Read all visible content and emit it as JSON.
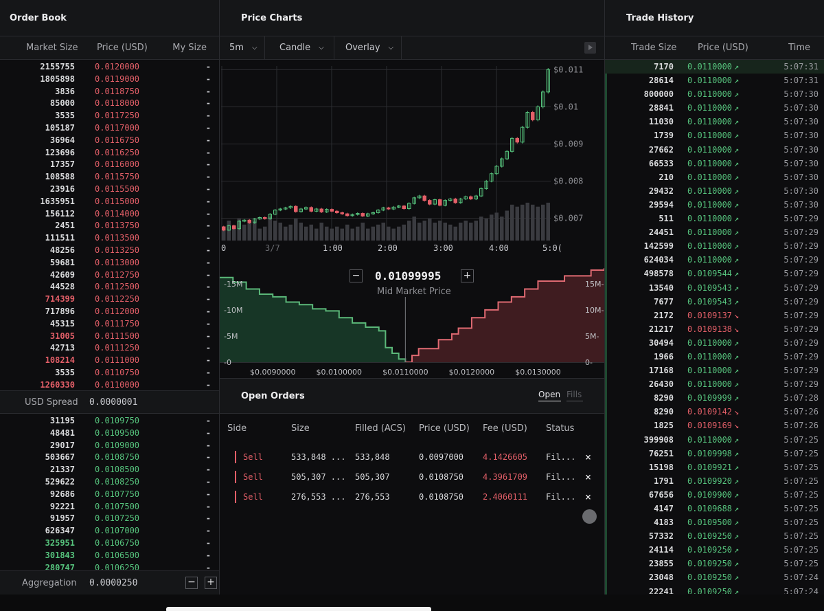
{
  "order_book": {
    "title": "Order Book",
    "col_market_size": "Market Size",
    "col_price": "Price (USD)",
    "col_my_size": "My Size",
    "asks": [
      {
        "size": "2155755",
        "price": "0.0120000",
        "my": "-"
      },
      {
        "size": "1805898",
        "price": "0.0119000",
        "my": "-"
      },
      {
        "size": "3836",
        "price": "0.0118750",
        "my": "-"
      },
      {
        "size": "85000",
        "price": "0.0118000",
        "my": "-"
      },
      {
        "size": "3535",
        "price": "0.0117250",
        "my": "-"
      },
      {
        "size": "105187",
        "price": "0.0117000",
        "my": "-"
      },
      {
        "size": "36964",
        "price": "0.0116750",
        "my": "-"
      },
      {
        "size": "123696",
        "price": "0.0116250",
        "my": "-"
      },
      {
        "size": "17357",
        "price": "0.0116000",
        "my": "-"
      },
      {
        "size": "108588",
        "price": "0.0115750",
        "my": "-"
      },
      {
        "size": "23916",
        "price": "0.0115500",
        "my": "-"
      },
      {
        "size": "1635951",
        "price": "0.0115000",
        "my": "-"
      },
      {
        "size": "156112",
        "price": "0.0114000",
        "my": "-"
      },
      {
        "size": "2451",
        "price": "0.0113750",
        "my": "-"
      },
      {
        "size": "111511",
        "price": "0.0113500",
        "my": "-"
      },
      {
        "size": "48256",
        "price": "0.0113250",
        "my": "-"
      },
      {
        "size": "59681",
        "price": "0.0113000",
        "my": "-"
      },
      {
        "size": "42609",
        "price": "0.0112750",
        "my": "-"
      },
      {
        "size": "44528",
        "price": "0.0112500",
        "my": "-"
      },
      {
        "size": "714399",
        "price": "0.0112250",
        "my": "-",
        "hl": true
      },
      {
        "size": "717896",
        "price": "0.0112000",
        "my": "-"
      },
      {
        "size": "45315",
        "price": "0.0111750",
        "my": "-"
      },
      {
        "size": "31005",
        "price": "0.0111500",
        "my": "-",
        "hl": true
      },
      {
        "size": "42713",
        "price": "0.0111250",
        "my": "-"
      },
      {
        "size": "108214",
        "price": "0.0111000",
        "my": "-",
        "hl": true
      },
      {
        "size": "3535",
        "price": "0.0110750",
        "my": "-"
      },
      {
        "size": "1260330",
        "price": "0.0110000",
        "my": "-",
        "hl": true
      }
    ],
    "spread_label": "USD Spread",
    "spread_value": "0.0000001",
    "bids": [
      {
        "size": "31195",
        "price": "0.0109750",
        "my": "-"
      },
      {
        "size": "48481",
        "price": "0.0109500",
        "my": "-"
      },
      {
        "size": "29017",
        "price": "0.0109000",
        "my": "-"
      },
      {
        "size": "503667",
        "price": "0.0108750",
        "my": "-"
      },
      {
        "size": "21337",
        "price": "0.0108500",
        "my": "-"
      },
      {
        "size": "529622",
        "price": "0.0108250",
        "my": "-"
      },
      {
        "size": "92686",
        "price": "0.0107750",
        "my": "-"
      },
      {
        "size": "92221",
        "price": "0.0107500",
        "my": "-"
      },
      {
        "size": "91957",
        "price": "0.0107250",
        "my": "-"
      },
      {
        "size": "626347",
        "price": "0.0107000",
        "my": "-"
      },
      {
        "size": "325951",
        "price": "0.0106750",
        "my": "-",
        "hl": true
      },
      {
        "size": "301843",
        "price": "0.0106500",
        "my": "-",
        "hl": true
      },
      {
        "size": "280747",
        "price": "0.0106250",
        "my": "-",
        "hl": true
      }
    ],
    "aggregation_label": "Aggregation",
    "aggregation_value": "0.0000250",
    "minus": "−",
    "plus": "+"
  },
  "price_charts": {
    "title": "Price Charts",
    "interval": "5m",
    "chart_type": "Candle",
    "overlay": "Overlay",
    "mid_market_price": "0.01099995",
    "mid_market_label": "Mid Market Price",
    "minus": "−",
    "plus": "+"
  },
  "chart_data": [
    {
      "type": "candlestick",
      "y_ticks": [
        "$0.011",
        "$0.01",
        "$0.009",
        "$0.008",
        "$0.007"
      ],
      "y_tick_values": [
        0.011,
        0.01,
        0.009,
        0.008,
        0.007
      ],
      "x_ticks": [
        "0",
        "3/7",
        "1:00",
        "2:00",
        "3:00",
        "4:00",
        "5:0("
      ],
      "ylim": [
        0.0064,
        0.0111
      ],
      "grid": true,
      "candles": [
        {
          "o": 0.00677,
          "c": 0.00668,
          "v": 0.3
        },
        {
          "o": 0.00668,
          "c": 0.0068,
          "v": 0.5
        },
        {
          "o": 0.0068,
          "c": 0.00672,
          "v": 0.35
        },
        {
          "o": 0.00672,
          "c": 0.00692,
          "v": 0.55
        },
        {
          "o": 0.00692,
          "c": 0.00695,
          "v": 0.4
        },
        {
          "o": 0.00695,
          "c": 0.00688,
          "v": 0.45
        },
        {
          "o": 0.00688,
          "c": 0.00698,
          "v": 0.5
        },
        {
          "o": 0.00698,
          "c": 0.00702,
          "v": 0.3
        },
        {
          "o": 0.00702,
          "c": 0.00699,
          "v": 0.35
        },
        {
          "o": 0.00699,
          "c": 0.00711,
          "v": 0.6
        },
        {
          "o": 0.00711,
          "c": 0.00722,
          "v": 0.5
        },
        {
          "o": 0.00722,
          "c": 0.00725,
          "v": 0.45
        },
        {
          "o": 0.00725,
          "c": 0.00728,
          "v": 0.35
        },
        {
          "o": 0.00728,
          "c": 0.00732,
          "v": 0.4
        },
        {
          "o": 0.00732,
          "c": 0.00718,
          "v": 0.55
        },
        {
          "o": 0.00718,
          "c": 0.00725,
          "v": 0.45
        },
        {
          "o": 0.00725,
          "c": 0.00729,
          "v": 0.35
        },
        {
          "o": 0.00729,
          "c": 0.00719,
          "v": 0.4
        },
        {
          "o": 0.00719,
          "c": 0.00725,
          "v": 0.3
        },
        {
          "o": 0.00725,
          "c": 0.00717,
          "v": 0.45
        },
        {
          "o": 0.00717,
          "c": 0.00724,
          "v": 0.35
        },
        {
          "o": 0.00724,
          "c": 0.00719,
          "v": 0.3
        },
        {
          "o": 0.00719,
          "c": 0.00715,
          "v": 0.35
        },
        {
          "o": 0.00715,
          "c": 0.00712,
          "v": 0.3
        },
        {
          "o": 0.00712,
          "c": 0.00707,
          "v": 0.4
        },
        {
          "o": 0.00707,
          "c": 0.0071,
          "v": 0.3
        },
        {
          "o": 0.0071,
          "c": 0.00713,
          "v": 0.35
        },
        {
          "o": 0.00713,
          "c": 0.00706,
          "v": 0.45
        },
        {
          "o": 0.00706,
          "c": 0.00712,
          "v": 0.3
        },
        {
          "o": 0.00712,
          "c": 0.00715,
          "v": 0.35
        },
        {
          "o": 0.00715,
          "c": 0.00722,
          "v": 0.4
        },
        {
          "o": 0.00722,
          "c": 0.00728,
          "v": 0.45
        },
        {
          "o": 0.00728,
          "c": 0.00725,
          "v": 0.35
        },
        {
          "o": 0.00725,
          "c": 0.0073,
          "v": 0.3
        },
        {
          "o": 0.0073,
          "c": 0.00733,
          "v": 0.35
        },
        {
          "o": 0.00733,
          "c": 0.00726,
          "v": 0.4
        },
        {
          "o": 0.00726,
          "c": 0.0074,
          "v": 0.5
        },
        {
          "o": 0.0074,
          "c": 0.00755,
          "v": 0.6
        },
        {
          "o": 0.00755,
          "c": 0.0076,
          "v": 0.45
        },
        {
          "o": 0.0076,
          "c": 0.00748,
          "v": 0.5
        },
        {
          "o": 0.00748,
          "c": 0.00738,
          "v": 0.55
        },
        {
          "o": 0.00738,
          "c": 0.0075,
          "v": 0.45
        },
        {
          "o": 0.0075,
          "c": 0.00735,
          "v": 0.5
        },
        {
          "o": 0.00735,
          "c": 0.00748,
          "v": 0.45
        },
        {
          "o": 0.00748,
          "c": 0.00752,
          "v": 0.4
        },
        {
          "o": 0.00752,
          "c": 0.00742,
          "v": 0.35
        },
        {
          "o": 0.00742,
          "c": 0.00752,
          "v": 0.45
        },
        {
          "o": 0.00752,
          "c": 0.00758,
          "v": 0.5
        },
        {
          "o": 0.00758,
          "c": 0.00752,
          "v": 0.45
        },
        {
          "o": 0.00752,
          "c": 0.0076,
          "v": 0.5
        },
        {
          "o": 0.0076,
          "c": 0.0078,
          "v": 0.6
        },
        {
          "o": 0.0078,
          "c": 0.008,
          "v": 0.55
        },
        {
          "o": 0.008,
          "c": 0.0082,
          "v": 0.65
        },
        {
          "o": 0.0082,
          "c": 0.0084,
          "v": 0.7
        },
        {
          "o": 0.0084,
          "c": 0.0086,
          "v": 0.6
        },
        {
          "o": 0.0086,
          "c": 0.0088,
          "v": 0.75
        },
        {
          "o": 0.0088,
          "c": 0.00915,
          "v": 0.9
        },
        {
          "o": 0.00915,
          "c": 0.00905,
          "v": 0.85
        },
        {
          "o": 0.00905,
          "c": 0.00945,
          "v": 0.9
        },
        {
          "o": 0.00945,
          "c": 0.00985,
          "v": 0.95
        },
        {
          "o": 0.00985,
          "c": 0.00965,
          "v": 0.9
        },
        {
          "o": 0.00965,
          "c": 0.01,
          "v": 0.85
        },
        {
          "o": 0.01,
          "c": 0.0104,
          "v": 0.9
        },
        {
          "o": 0.0104,
          "c": 0.011,
          "v": 0.95
        }
      ]
    },
    {
      "type": "depth",
      "mid": 0.011,
      "x_ticks": [
        "$0.0090000",
        "$0.0100000",
        "$0.0110000",
        "$0.0120000",
        "$0.0130000"
      ],
      "x_tick_values": [
        0.009,
        0.01,
        0.011,
        0.012,
        0.013
      ],
      "y_ticks_left": [
        "15M",
        "10M",
        "5M",
        "0"
      ],
      "y_ticks_right": [
        "15M",
        "10M",
        "5M",
        "0"
      ],
      "y_tick_values": [
        15000000,
        10000000,
        5000000,
        0
      ],
      "xlim": [
        0.0082,
        0.014
      ],
      "ylim": [
        0,
        18000000
      ],
      "bids": [
        [
          0.0082,
          16200000
        ],
        [
          0.0084,
          15300000
        ],
        [
          0.0086,
          14000000
        ],
        [
          0.0088,
          13000000
        ],
        [
          0.009,
          12500000
        ],
        [
          0.0092,
          11500000
        ],
        [
          0.0094,
          11000000
        ],
        [
          0.0096,
          10200000
        ],
        [
          0.0098,
          9800000
        ],
        [
          0.01,
          8500000
        ],
        [
          0.0102,
          7500000
        ],
        [
          0.0104,
          6700000
        ],
        [
          0.0106,
          6000000
        ],
        [
          0.0107,
          2800000
        ],
        [
          0.0108,
          1700000
        ],
        [
          0.0109,
          600000
        ],
        [
          0.011,
          0
        ]
      ],
      "asks": [
        [
          0.011,
          0
        ],
        [
          0.0111,
          1300000
        ],
        [
          0.0112,
          2600000
        ],
        [
          0.0115,
          4300000
        ],
        [
          0.0117,
          5400000
        ],
        [
          0.0118,
          6500000
        ],
        [
          0.012,
          8500000
        ],
        [
          0.0122,
          10000000
        ],
        [
          0.0124,
          11500000
        ],
        [
          0.0126,
          12500000
        ],
        [
          0.0128,
          14000000
        ],
        [
          0.013,
          15500000
        ],
        [
          0.0134,
          16500000
        ],
        [
          0.0138,
          17600000
        ],
        [
          0.014,
          18000000
        ]
      ]
    }
  ],
  "trade_history": {
    "title": "Trade History",
    "col_trade_size": "Trade Size",
    "col_price": "Price (USD)",
    "col_time": "Time",
    "trades": [
      {
        "size": "7170",
        "price": "0.0110000",
        "dir": "up",
        "time": "5:07:31"
      },
      {
        "size": "28614",
        "price": "0.0110000",
        "dir": "up",
        "time": "5:07:31"
      },
      {
        "size": "800000",
        "price": "0.0110000",
        "dir": "up",
        "time": "5:07:30"
      },
      {
        "size": "28841",
        "price": "0.0110000",
        "dir": "up",
        "time": "5:07:30"
      },
      {
        "size": "11030",
        "price": "0.0110000",
        "dir": "up",
        "time": "5:07:30"
      },
      {
        "size": "1739",
        "price": "0.0110000",
        "dir": "up",
        "time": "5:07:30"
      },
      {
        "size": "27662",
        "price": "0.0110000",
        "dir": "up",
        "time": "5:07:30"
      },
      {
        "size": "66533",
        "price": "0.0110000",
        "dir": "up",
        "time": "5:07:30"
      },
      {
        "size": "210",
        "price": "0.0110000",
        "dir": "up",
        "time": "5:07:30"
      },
      {
        "size": "29432",
        "price": "0.0110000",
        "dir": "up",
        "time": "5:07:30"
      },
      {
        "size": "29594",
        "price": "0.0110000",
        "dir": "up",
        "time": "5:07:30"
      },
      {
        "size": "511",
        "price": "0.0110000",
        "dir": "up",
        "time": "5:07:29"
      },
      {
        "size": "24451",
        "price": "0.0110000",
        "dir": "up",
        "time": "5:07:29"
      },
      {
        "size": "142599",
        "price": "0.0110000",
        "dir": "up",
        "time": "5:07:29"
      },
      {
        "size": "624034",
        "price": "0.0110000",
        "dir": "up",
        "time": "5:07:29"
      },
      {
        "size": "498578",
        "price": "0.0109544",
        "dir": "up",
        "time": "5:07:29"
      },
      {
        "size": "13540",
        "price": "0.0109543",
        "dir": "up",
        "time": "5:07:29"
      },
      {
        "size": "7677",
        "price": "0.0109543",
        "dir": "up",
        "time": "5:07:29"
      },
      {
        "size": "2172",
        "price": "0.0109137",
        "dir": "dn",
        "time": "5:07:29"
      },
      {
        "size": "21217",
        "price": "0.0109138",
        "dir": "dn",
        "time": "5:07:29"
      },
      {
        "size": "30494",
        "price": "0.0110000",
        "dir": "up",
        "time": "5:07:29"
      },
      {
        "size": "1966",
        "price": "0.0110000",
        "dir": "up",
        "time": "5:07:29"
      },
      {
        "size": "17168",
        "price": "0.0110000",
        "dir": "up",
        "time": "5:07:29"
      },
      {
        "size": "26430",
        "price": "0.0110000",
        "dir": "up",
        "time": "5:07:29"
      },
      {
        "size": "8290",
        "price": "0.0109999",
        "dir": "up",
        "time": "5:07:28"
      },
      {
        "size": "8290",
        "price": "0.0109142",
        "dir": "dn",
        "time": "5:07:26"
      },
      {
        "size": "1825",
        "price": "0.0109169",
        "dir": "dn",
        "time": "5:07:26"
      },
      {
        "size": "399908",
        "price": "0.0110000",
        "dir": "up",
        "time": "5:07:25"
      },
      {
        "size": "76251",
        "price": "0.0109998",
        "dir": "up",
        "time": "5:07:25"
      },
      {
        "size": "15198",
        "price": "0.0109921",
        "dir": "up",
        "time": "5:07:25"
      },
      {
        "size": "1791",
        "price": "0.0109920",
        "dir": "up",
        "time": "5:07:25"
      },
      {
        "size": "67656",
        "price": "0.0109900",
        "dir": "up",
        "time": "5:07:25"
      },
      {
        "size": "4147",
        "price": "0.0109688",
        "dir": "up",
        "time": "5:07:25"
      },
      {
        "size": "4183",
        "price": "0.0109500",
        "dir": "up",
        "time": "5:07:25"
      },
      {
        "size": "57332",
        "price": "0.0109250",
        "dir": "up",
        "time": "5:07:25"
      },
      {
        "size": "24114",
        "price": "0.0109250",
        "dir": "up",
        "time": "5:07:25"
      },
      {
        "size": "23855",
        "price": "0.0109250",
        "dir": "up",
        "time": "5:07:25"
      },
      {
        "size": "23048",
        "price": "0.0109250",
        "dir": "up",
        "time": "5:07:24"
      },
      {
        "size": "22241",
        "price": "0.0109250",
        "dir": "up",
        "time": "5:07:24"
      }
    ]
  },
  "open_orders": {
    "title": "Open Orders",
    "tab_open": "Open",
    "tab_fills": "Fills",
    "col_side": "Side",
    "col_size": "Size",
    "col_filled": "Filled (ACS)",
    "col_price": "Price (USD)",
    "col_fee": "Fee (USD)",
    "col_status": "Status",
    "cancel_glyph": "×",
    "orders": [
      {
        "side": "Sell",
        "size": "533,848 ...",
        "filled": "533,848",
        "price": "0.0097000",
        "fee": "4.1426605",
        "status": "Fil..."
      },
      {
        "side": "Sell",
        "size": "505,307 ...",
        "filled": "505,307",
        "price": "0.0108750",
        "fee": "4.3961709",
        "status": "Fil..."
      },
      {
        "side": "Sell",
        "size": "276,553 ...",
        "filled": "276,553",
        "price": "0.0108750",
        "fee": "2.4060111",
        "status": "Fil..."
      }
    ]
  },
  "colors": {
    "green": "#56c37d",
    "red": "#e35f68",
    "bg": "#0d0d0f",
    "panel_head": "#151618"
  }
}
